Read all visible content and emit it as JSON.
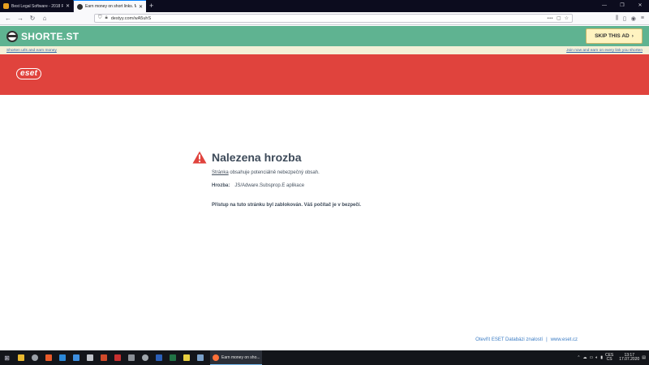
{
  "browser": {
    "tabs": [
      {
        "title": "Best Legal Software - 2018 Ra...",
        "active": false,
        "favicon_color": "#e8a020"
      },
      {
        "title": "Earn money on short links. Ma...",
        "active": true,
        "favicon_color": "#2f2f2f"
      }
    ],
    "new_tab": "+",
    "url": "destyy.com/wA5uhS"
  },
  "shorte": {
    "logo_text": "SHORTE.ST",
    "skip_label": "SKIP THIS AD",
    "promo_left": "Shorten urls and earn money",
    "promo_right": "Join now and earn on every link you shorten"
  },
  "eset": {
    "logo": "eset",
    "heading": "Nalezena hrozba",
    "line1_link": "Stránka",
    "line1_rest": " obsahuje potenciálně nebezpečný obsah.",
    "threat_label": "Hrozba:",
    "threat_value": "JS/Adware.Subsprop.E aplikace",
    "blocked": "Přístup na tuto stránku byl zablokován. Váš počítač je v bezpečí.",
    "footer_link1": "Otevřít ESET Databázi znalostí",
    "footer_sep": "|",
    "footer_link2": "www.eset.cz",
    "accent": "#e0433d"
  },
  "taskbar": {
    "active_app": "Earn money on sho...",
    "lang_top": "CES",
    "lang_bottom": "CS",
    "time": "13:17",
    "date": "17.07.2020"
  }
}
